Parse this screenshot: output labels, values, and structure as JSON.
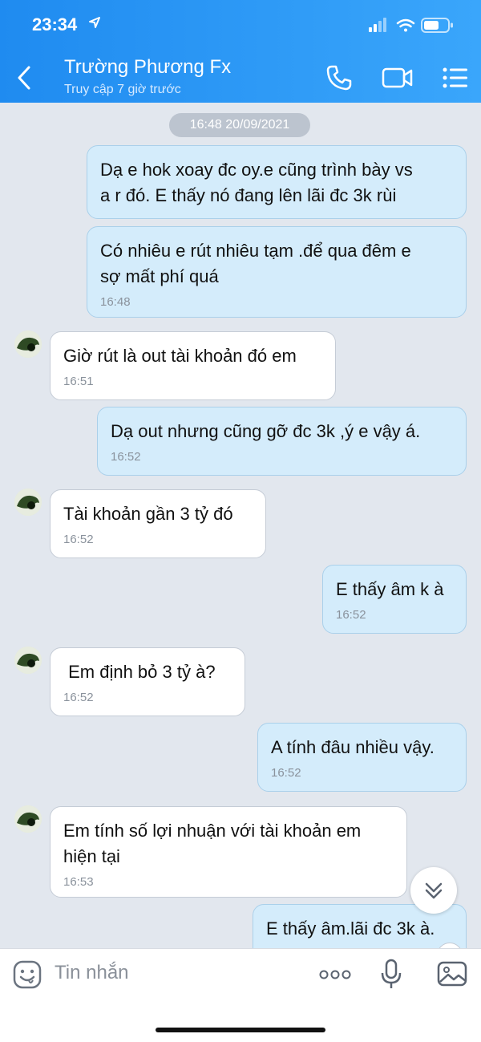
{
  "status_bar": {
    "time": "23:34"
  },
  "header": {
    "contact_name": "Trường Phương Fx",
    "subtitle": "Truy cập 7 giờ trước"
  },
  "chat": {
    "date_separator": "16:48 20/09/2021",
    "messages": [
      {
        "direction": "outgoing",
        "lines": [
          "Dạ e hok xoay đc oy.e cũng trình bày vs",
          "a r đó. E thấy nó đang lên lãi đc 3k rùi"
        ],
        "time": ""
      },
      {
        "direction": "outgoing",
        "lines": [
          "Có nhiêu e rút nhiêu tạm .để qua đêm e",
          "sợ mất phí quá"
        ],
        "time": "16:48"
      },
      {
        "direction": "incoming",
        "lines": [
          "Giờ rút là out tài khoản đó em"
        ],
        "time": "16:51"
      },
      {
        "direction": "outgoing",
        "lines": [
          "Dạ out nhưng cũng gỡ đc 3k ,ý e vậy á."
        ],
        "time": "16:52"
      },
      {
        "direction": "incoming",
        "lines": [
          "Tài khoản gần 3 tỷ đó"
        ],
        "time": "16:52"
      },
      {
        "direction": "outgoing",
        "lines": [
          "E thấy âm k à"
        ],
        "time": "16:52"
      },
      {
        "direction": "incoming",
        "lines": [
          " Em định bỏ 3 tỷ à?"
        ],
        "time": "16:52"
      },
      {
        "direction": "outgoing",
        "lines": [
          "A tính đâu nhiều vậy."
        ],
        "time": "16:52"
      },
      {
        "direction": "incoming",
        "lines": [
          "Em tính số lợi nhuận với tài khoản em",
          "hiện tại"
        ],
        "time": "16:53"
      },
      {
        "direction": "outgoing",
        "lines": [
          "E thấy âm.lãi đc 3k à."
        ],
        "time": ""
      }
    ]
  },
  "composer": {
    "placeholder": "Tin nhắn"
  },
  "icons": {
    "back": "chevron-left-icon",
    "call": "phone-icon",
    "video": "video-icon",
    "menu": "list-icon",
    "emoji": "emoji-icon",
    "more": "more-dots-icon",
    "mic": "microphone-icon",
    "image": "image-icon",
    "scroll": "double-chevron-down-icon"
  }
}
